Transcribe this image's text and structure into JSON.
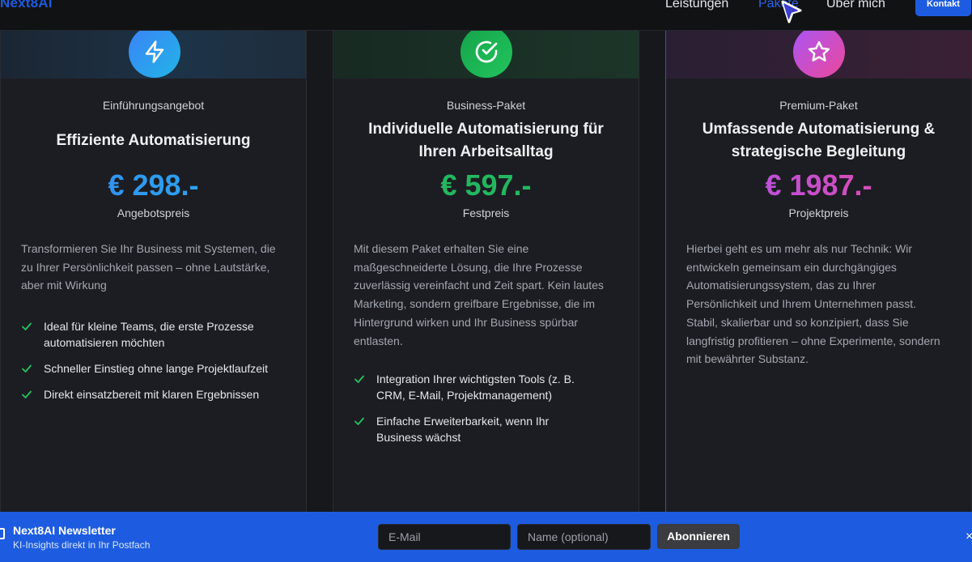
{
  "header": {
    "logo": "Next8AI",
    "nav": [
      {
        "label": "Leistungen"
      },
      {
        "label": "Pakete"
      },
      {
        "label": "Über mich"
      }
    ],
    "contact_label": "Kontakt",
    "accent_color": "#1d5ce0"
  },
  "cards": [
    {
      "icon": "lightning-icon",
      "eyebrow": "Einführungsangebot",
      "title": "Effiziente Automatisierung",
      "price": "€ 298.-",
      "price_label": "Angebotspreis",
      "description": "Transformieren Sie Ihr Business mit Systemen, die zu Ihrer Persönlichkeit passen – ohne Lautstärke, aber mit Wirkung",
      "features": [
        "Ideal für kleine Teams, die erste Prozesse automatisieren möchten",
        "Schneller Einstieg ohne lange Projektlaufzeit",
        "Direkt einsatzbereit mit klaren Ergebnissen"
      ]
    },
    {
      "icon": "check-circle-icon",
      "eyebrow": "Business-Paket",
      "title": "Individuelle Automatisierung für Ihren Arbeitsalltag",
      "price": "€ 597.-",
      "price_label": "Festpreis",
      "description": "Mit diesem Paket erhalten Sie eine maßgeschneiderte Lösung, die Ihre Prozesse zuverlässig vereinfacht und Zeit spart. Kein lautes Marketing, sondern greifbare Ergebnisse, die im Hintergrund wirken und Ihr Business spürbar entlasten.",
      "features": [
        "Integration Ihrer wichtigsten Tools (z. B. CRM, E-Mail, Projektmanagement)",
        "Einfache Erweiterbarkeit, wenn Ihr Business wächst"
      ]
    },
    {
      "icon": "star-icon",
      "eyebrow": "Premium-Paket",
      "title": "Umfassende Automatisierung & strategische Begleitung",
      "price": "€ 1987.-",
      "price_label": "Projektpreis",
      "description": "Hierbei geht es um mehr als nur Technik: Wir entwickeln gemeinsam ein durchgängiges Automatisierungssystem, das zu Ihrer Persönlichkeit und Ihrem Unternehmen passt. Stabil, skalierbar und so konzipiert, dass Sie langfristig profitieren – ohne Experimente, sondern mit bewährter Substanz.",
      "features": []
    }
  ],
  "newsletter": {
    "title": "Next8AI Newsletter",
    "subtitle": "KI-Insights direkt in Ihr Postfach",
    "email_placeholder": "E-Mail",
    "name_placeholder": "Name (optional)",
    "subscribe_label": "Abonnieren",
    "close_symbol": "×"
  }
}
